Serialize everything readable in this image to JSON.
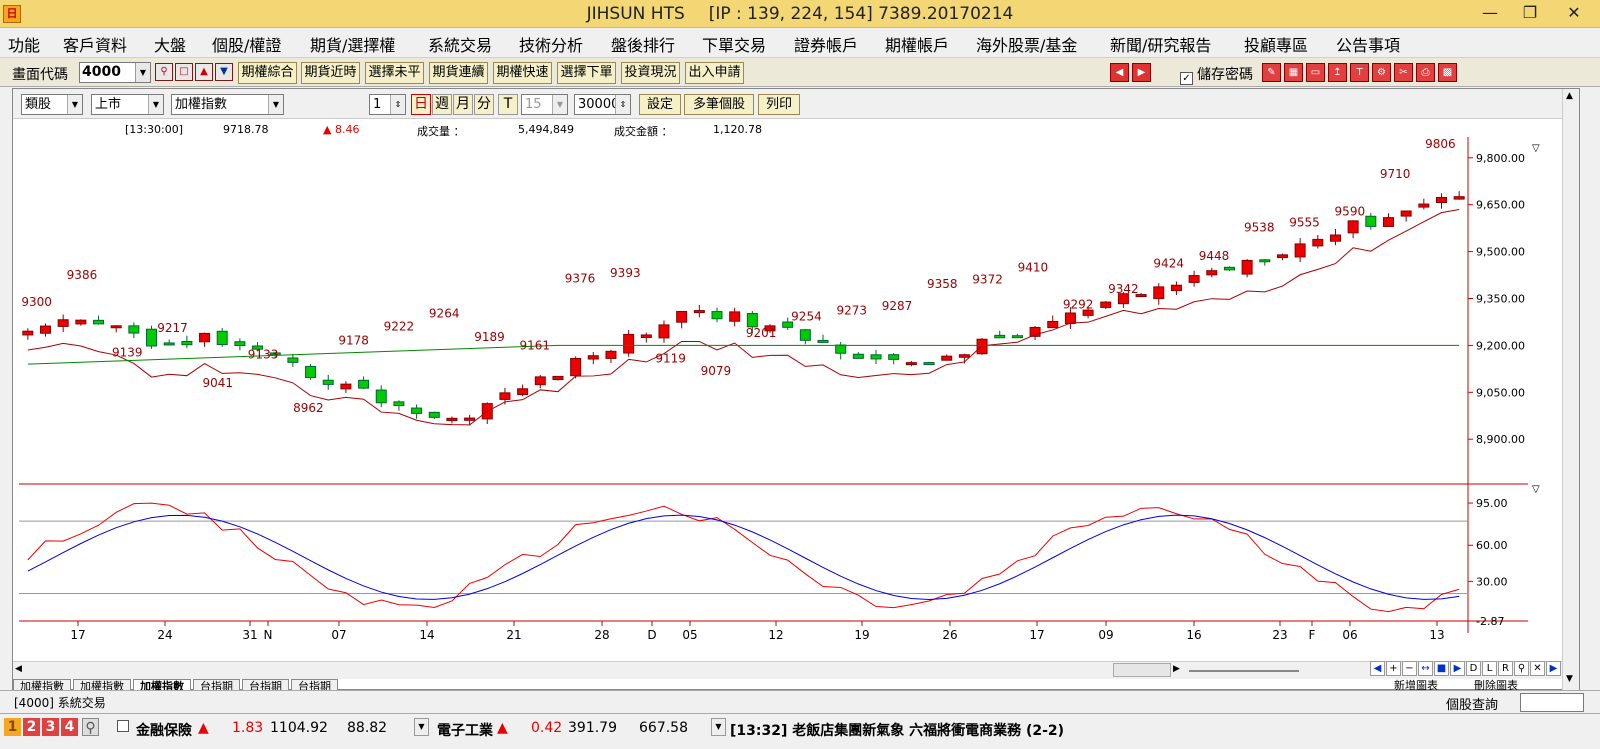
{
  "window": {
    "title": "JIHSUN HTS",
    "ip": "[IP : 139, 224, 154] 7389.20170214"
  },
  "menu": [
    "功能",
    "客戶資料",
    "大盤",
    "個股/權證",
    "期貨/選擇權",
    "系統交易",
    "技術分析",
    "盤後排行",
    "下單交易",
    "證券帳戶",
    "期權帳戶",
    "海外股票/基金",
    "新聞/研究報告",
    "投顧專區",
    "公告事項"
  ],
  "toolbar": {
    "code_label": "畫面代碼",
    "code_value": "4000",
    "buttons": [
      "期權綜合",
      "期貨近時",
      "選擇未平",
      "期貨連續",
      "期權快速",
      "選擇下單",
      "投資現況",
      "出入申請"
    ],
    "save_pw": "儲存密碼"
  },
  "controls": {
    "category": "類股",
    "market": "上市",
    "index": "加權指數",
    "count": "1",
    "periods": [
      "日",
      "週",
      "月",
      "分",
      "T"
    ],
    "minutes": "15",
    "bars": "30000",
    "btn_settings": "設定",
    "btn_multi": "多筆個股",
    "btn_print": "列印"
  },
  "info": {
    "time": "[13:30:00]",
    "price": "9718.78",
    "change": "▲ 8.46",
    "vol_label": "成交量 ：",
    "vol": "5,494,849",
    "amt_label": "成交金額 ：",
    "amt": "1,120.78"
  },
  "axes": {
    "price_ticks": [
      "9,800.00",
      "9,650.00",
      "9,500.00",
      "9,350.00",
      "9,200.00",
      "9,050.00",
      "8,900.00"
    ],
    "kd_ticks": [
      "95.00",
      "60.00",
      "30.00",
      "-2.87"
    ],
    "dates": [
      "17",
      "24",
      "31",
      "N",
      "07",
      "14",
      "21",
      "28",
      "D",
      "05",
      "12",
      "19",
      "26",
      "17",
      "09",
      "16",
      "23",
      "F",
      "06",
      "13"
    ]
  },
  "chart_data": {
    "type": "candlestick",
    "price_axis_range": [
      8760,
      9860
    ],
    "kd_axis_range": [
      -2.87,
      110
    ],
    "labels": [
      {
        "text": "9300"
      },
      {
        "text": "9386"
      },
      {
        "text": "9139"
      },
      {
        "text": "9217"
      },
      {
        "text": "9041"
      },
      {
        "text": "9133"
      },
      {
        "text": "8962"
      },
      {
        "text": "9178"
      },
      {
        "text": "9222"
      },
      {
        "text": "9264"
      },
      {
        "text": "9189"
      },
      {
        "text": "9161"
      },
      {
        "text": "9376"
      },
      {
        "text": "9393"
      },
      {
        "text": "9119"
      },
      {
        "text": "9079"
      },
      {
        "text": "9201"
      },
      {
        "text": "9254"
      },
      {
        "text": "9273"
      },
      {
        "text": "9287"
      },
      {
        "text": "9358"
      },
      {
        "text": "9372"
      },
      {
        "text": "9410"
      },
      {
        "text": "9292"
      },
      {
        "text": "9342"
      },
      {
        "text": "9424"
      },
      {
        "text": "9448"
      },
      {
        "text": "9538"
      },
      {
        "text": "9555"
      },
      {
        "text": "9590"
      },
      {
        "text": "9710"
      },
      {
        "text": "9806"
      }
    ]
  },
  "tabs": [
    "加權指數",
    "加權指數",
    "加權指數",
    "台指期",
    "台指期",
    "台指期"
  ],
  "scroll_labels": [
    "新增圖表",
    "刪除圖表"
  ],
  "status": {
    "left": "[4000] 系統交易",
    "query": "個股查詢"
  },
  "bottom": {
    "nums": [
      "1",
      "2",
      "3",
      "4"
    ],
    "ins_name": "金融保險",
    "ins_chg": "1.83",
    "ins_price": "1104.92",
    "ins_vol": "88.82",
    "ele_name": "電子工業",
    "ele_chg": "0.42",
    "ele_price": "391.79",
    "ele_vol": "667.58",
    "news": "[13:32] 老飯店集團新氣象 六福將衝電商業務 (2-2)"
  }
}
